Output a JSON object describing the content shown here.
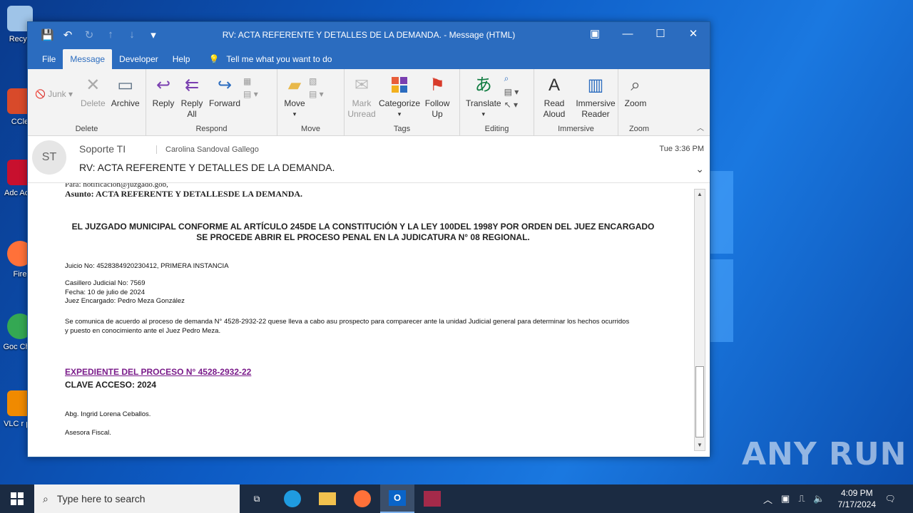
{
  "desktop": {
    "icons": [
      {
        "label": "Recyc",
        "color": "#9fc4e8"
      },
      {
        "label": "CCle",
        "color": "#d84a2a"
      },
      {
        "label": "Adc Acro",
        "color": "#c8102e"
      },
      {
        "label": "Fire",
        "color": "#ff7139"
      },
      {
        "label": "Goc Chro",
        "color": "#34a853"
      },
      {
        "label": "VLC r pla",
        "color": "#f08a00"
      }
    ],
    "watermark": "ANY RUN"
  },
  "window": {
    "title": "RV: ACTA REFERENTE Y DETALLES DE LA DEMANDA.  -  Message (HTML)",
    "menu": [
      "File",
      "Message",
      "Developer",
      "Help"
    ],
    "active_menu": "Message",
    "tell_me": "Tell me what you want to do"
  },
  "ribbon": {
    "delete_group": {
      "junk": "Junk",
      "delete": "Delete",
      "archive": "Archive",
      "label": "Delete"
    },
    "respond_group": {
      "reply": "Reply",
      "reply_all": "Reply All",
      "forward": "Forward",
      "label": "Respond"
    },
    "move_group": {
      "move": "Move",
      "label": "Move"
    },
    "tags_group": {
      "mark_unread": "Mark Unread",
      "categorize": "Categorize",
      "follow_up": "Follow Up",
      "label": "Tags"
    },
    "editing_group": {
      "translate": "Translate",
      "label": "Editing"
    },
    "immersive_group": {
      "read_aloud": "Read Aloud",
      "immersive_reader": "Immersive Reader",
      "label": "Immersive"
    },
    "zoom_group": {
      "zoom": "Zoom",
      "label": "Zoom"
    }
  },
  "message": {
    "avatar_initials": "ST",
    "sender": "Soporte TI",
    "recipient": "Carolina Sandoval Gallego",
    "time": "Tue 3:36 PM",
    "subject": "RV: ACTA REFERENTE Y DETALLES DE LA DEMANDA."
  },
  "body": {
    "de_line": "Para: notificacion@juzgado.gob,",
    "asunto": "Asunto: ACTA REFERENTE Y DETALLESDE LA DEMANDA.",
    "heading_line1": "EL JUZGADO MUNICIPAL CONFORME AL ARTÍCULO 245DE LA CONSTITUCIÓN Y LA LEY 100DEL 1998Y POR ORDEN DEL JUEZ ENCARGADO",
    "heading_line2": "SE PROCEDE ABRIR EL PROCESO PENAL EN LA JUDICATURA N° 08 REGIONAL.",
    "juicio": "Juicio No: 4528384920230412, PRIMERA INSTANCIA",
    "casillero": "Casillero Judicial No: 7569",
    "fecha": "Fecha: 10 de julio de 2024",
    "juez": "Juez Encargado: Pedro Meza González",
    "paragraph_line1": "Se comunica de acuerdo al proceso de demanda N° 4528-2932-22 quese lleva a cabo asu prospecto para comparecer ante la unidad Judicial general para determinar los hechos ocurridos",
    "paragraph_line2": "y puesto en conocimiento ante el Juez Pedro Meza.",
    "expediente_link": "EXPEDIENTE DEL PROCESO N° 4528-2932-22",
    "clave": "CLAVE ACCESO: 2024",
    "firma": "Abg. Ingrid Lorena Ceballos.",
    "cargo": "Asesora Fiscal."
  },
  "taskbar": {
    "search_placeholder": "Type here to search",
    "time": "4:09 PM",
    "date": "7/17/2024"
  }
}
